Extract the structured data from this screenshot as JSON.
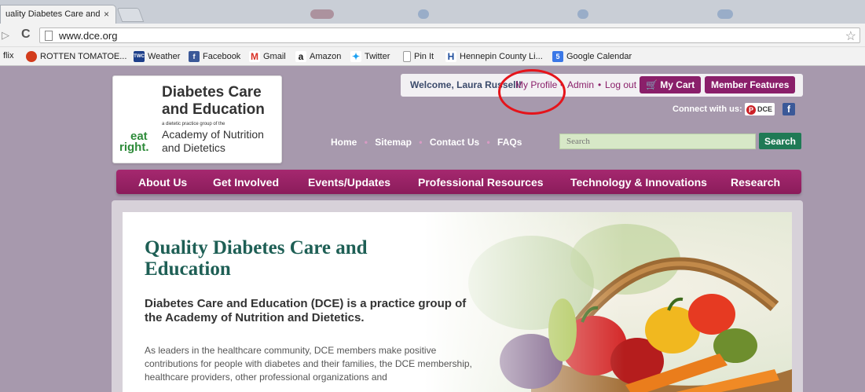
{
  "browser": {
    "tab_title": "uality Diabetes Care and",
    "tab_close": "×",
    "url": "www.dce.org",
    "bookmarks": [
      {
        "label": "flix",
        "icon": "netflix-icon"
      },
      {
        "label": "ROTTEN TOMATOE...",
        "icon": "tomato-icon"
      },
      {
        "label": "Weather",
        "icon": "twc-icon",
        "icon_text": "TWC"
      },
      {
        "label": "Facebook",
        "icon": "facebook-icon",
        "icon_text": "f"
      },
      {
        "label": "Gmail",
        "icon": "gmail-icon",
        "icon_text": "M"
      },
      {
        "label": "Amazon",
        "icon": "amazon-icon",
        "icon_text": "a"
      },
      {
        "label": "Twitter",
        "icon": "twitter-icon"
      },
      {
        "label": "Pin It",
        "icon": "page-icon"
      },
      {
        "label": "Hennepin County Li...",
        "icon": "hennepin-icon",
        "icon_text": "H"
      },
      {
        "label": "Google Calendar",
        "icon": "calendar-icon",
        "icon_text": "5"
      }
    ]
  },
  "site": {
    "logo": {
      "title_line1": "Diabetes Care",
      "title_line2": "and Education",
      "small": "a dietetic practice group of the",
      "academy_line1": "Academy of Nutrition",
      "academy_line2": "and Dietetics",
      "eat": "eat",
      "right": "right."
    },
    "user_bar": {
      "welcome": "Welcome, Laura Russell!",
      "my_profile": "My Profile",
      "admin": "Admin",
      "logout": "Log out",
      "sep": "•",
      "my_cart": "My Cart",
      "member_features": "Member Features"
    },
    "connect": {
      "label": "Connect with us:",
      "pinterest": "DCE",
      "pinterest_p": "P",
      "facebook": "f"
    },
    "top_nav": [
      "Home",
      "Sitemap",
      "Contact Us",
      "FAQs"
    ],
    "top_nav_sep": "•",
    "search": {
      "placeholder": "Search",
      "button": "Search"
    },
    "main_nav": [
      "About Us",
      "Get Involved",
      "Events/Updates",
      "Professional Resources",
      "Technology & Innovations",
      "Research"
    ],
    "hero": {
      "title": "Quality Diabetes Care and Education",
      "subtitle": "Diabetes Care and Education (DCE) is a practice group of the Academy of Nutrition and Dietetics.",
      "body": "As leaders in the healthcare community, DCE members make positive contributions for people with diabetes and their families, the DCE membership, healthcare providers, other professional organizations and"
    }
  },
  "colors": {
    "page_bg": "#a799ad",
    "accent": "#8a1f6a",
    "search_button": "#1f7a55",
    "title_green": "#1e5f55",
    "highlight": "#e5141b"
  }
}
